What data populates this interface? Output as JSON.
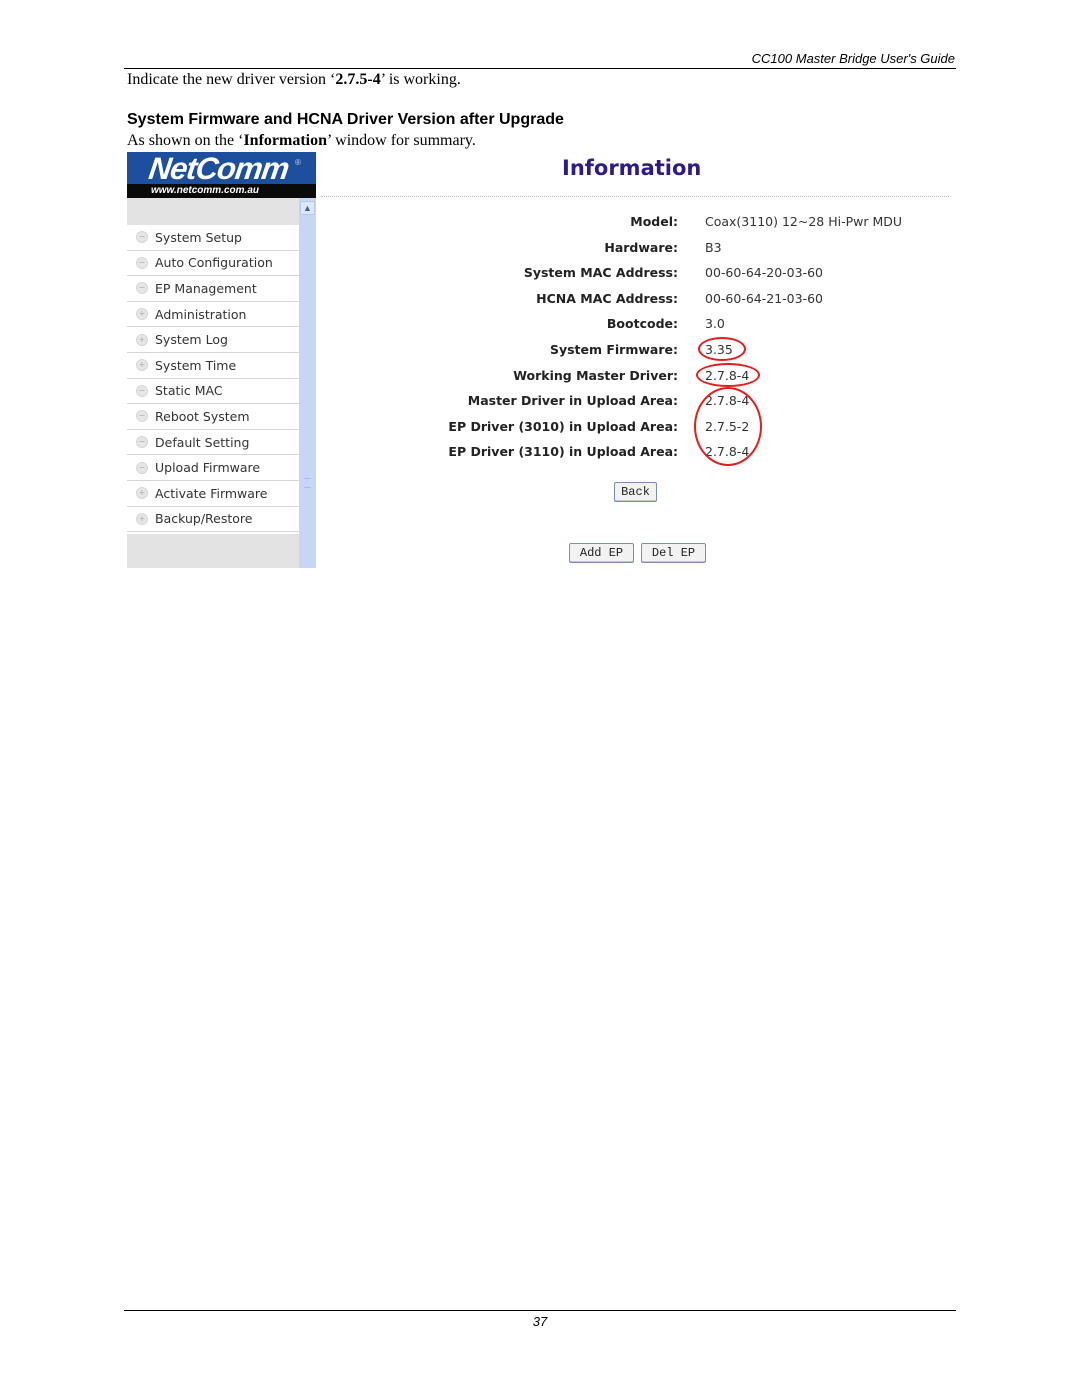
{
  "document": {
    "running_header": "CC100 Master Bridge User's Guide",
    "intro": {
      "prefix": "Indicate the new driver version ‘",
      "version": "2.7.5-4",
      "suffix": "’ is working."
    },
    "section_heading": "System Firmware and HCNA Driver Version after Upgrade",
    "summary": {
      "prefix": "As shown on the ‘",
      "emphasis": "Information",
      "suffix": "’ window for summary."
    },
    "page_number": "37"
  },
  "screenshot": {
    "logo": {
      "name": "NetComm",
      "registered": "®",
      "url": "www.netcomm.com.au"
    },
    "sidebar": {
      "items": [
        {
          "label": "System Setup",
          "bullet": "−"
        },
        {
          "label": "Auto Configuration",
          "bullet": "−"
        },
        {
          "label": "EP Management",
          "bullet": "−"
        },
        {
          "label": "Administration",
          "bullet": "+"
        },
        {
          "label": "System Log",
          "bullet": "+"
        },
        {
          "label": "System Time",
          "bullet": "+"
        },
        {
          "label": "Static MAC",
          "bullet": "−"
        },
        {
          "label": "Reboot System",
          "bullet": "−"
        },
        {
          "label": "Default Setting",
          "bullet": "−"
        },
        {
          "label": "Upload Firmware",
          "bullet": "−"
        },
        {
          "label": "Activate Firmware",
          "bullet": "+"
        },
        {
          "label": "Backup/Restore",
          "bullet": "+"
        }
      ]
    },
    "scrollbar": {
      "up_icon": "▲"
    },
    "info": {
      "title": "Information",
      "rows": [
        {
          "label": "Model:",
          "value": "Coax(3110) 12~28 Hi-Pwr MDU"
        },
        {
          "label": "Hardware:",
          "value": "B3"
        },
        {
          "label": "System MAC Address:",
          "value": "00-60-64-20-03-60"
        },
        {
          "label": "HCNA MAC Address:",
          "value": "00-60-64-21-03-60"
        },
        {
          "label": "Bootcode:",
          "value": "3.0"
        },
        {
          "label": "System Firmware:",
          "value": "3.35"
        },
        {
          "label": "Working Master Driver:",
          "value": "2.7.8-4"
        },
        {
          "label": "Master Driver in Upload Area:",
          "value": "2.7.8-4"
        },
        {
          "label": "EP Driver (3010) in Upload Area:",
          "value": "2.7.5-2"
        },
        {
          "label": "EP Driver (3110) in Upload Area:",
          "value": "2.7.8-4"
        }
      ],
      "highlight_color": "#e81c1c"
    },
    "buttons": {
      "back": "Back",
      "add_ep": "Add EP",
      "del_ep": "Del EP"
    },
    "colors": {
      "logo_blue": "#1c4f9e",
      "title_purple": "#2d1a8c",
      "scrollbar_blue": "#c5d6f7"
    }
  }
}
